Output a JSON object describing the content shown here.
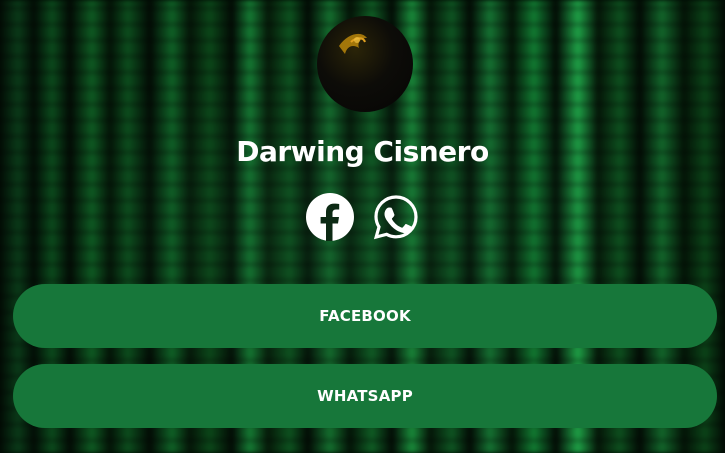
{
  "profile": {
    "name": "Darwing Cisnero"
  },
  "social_icons": [
    {
      "icon": "facebook-icon"
    },
    {
      "icon": "whatsapp-icon"
    }
  ],
  "links": [
    {
      "label": "FACEBOOK"
    },
    {
      "label": "WHATSAPP"
    }
  ],
  "colors": {
    "button_bg": "#17773a",
    "text": "#ffffff",
    "background_theme": "#0b4a1c"
  }
}
